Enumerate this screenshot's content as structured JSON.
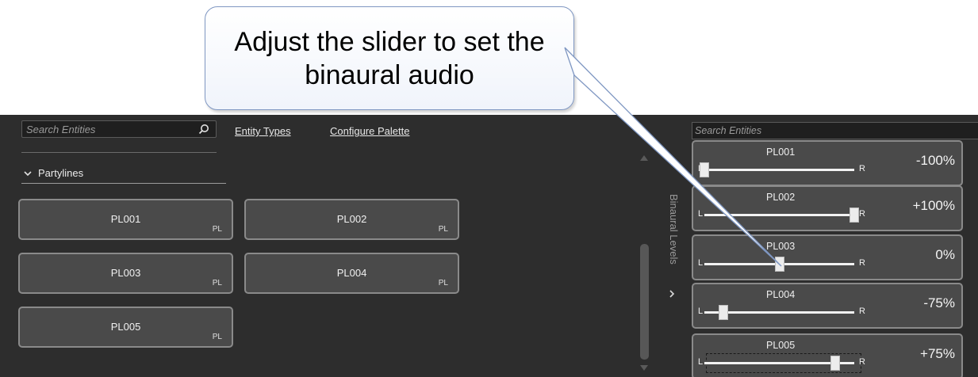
{
  "callout": {
    "text": "Adjust the slider to set the binaural audio"
  },
  "left_panel": {
    "search_placeholder": "Search Entities",
    "links": {
      "entity_types": "Entity Types",
      "configure_palette": "Configure Palette"
    },
    "group": {
      "label": "Partylines",
      "expanded": true
    },
    "entities": [
      {
        "name": "PL001",
        "tag": "PL"
      },
      {
        "name": "PL002",
        "tag": "PL"
      },
      {
        "name": "PL003",
        "tag": "PL"
      },
      {
        "name": "PL004",
        "tag": "PL"
      },
      {
        "name": "PL005",
        "tag": "PL"
      }
    ]
  },
  "side_tab": {
    "label": "Binaural Levels"
  },
  "right_panel": {
    "search_placeholder": "Search Entities",
    "cards": [
      {
        "name": "PL001",
        "left_label": "L",
        "right_label": "R",
        "value": "-100%",
        "pan": -100
      },
      {
        "name": "PL002",
        "left_label": "L",
        "right_label": "R",
        "value": "+100%",
        "pan": 100
      },
      {
        "name": "PL003",
        "left_label": "L",
        "right_label": "R",
        "value": "0%",
        "pan": 0
      },
      {
        "name": "PL004",
        "left_label": "L",
        "right_label": "R",
        "value": "-75%",
        "pan": -75
      },
      {
        "name": "PL005",
        "left_label": "L",
        "right_label": "R",
        "value": "+75%",
        "pan": 75,
        "focused": true
      }
    ]
  },
  "colors": {
    "background": "#2d2d2d",
    "button": "#4a4a4a",
    "border": "#8a8a8a",
    "callout_border": "#7f97c2"
  }
}
